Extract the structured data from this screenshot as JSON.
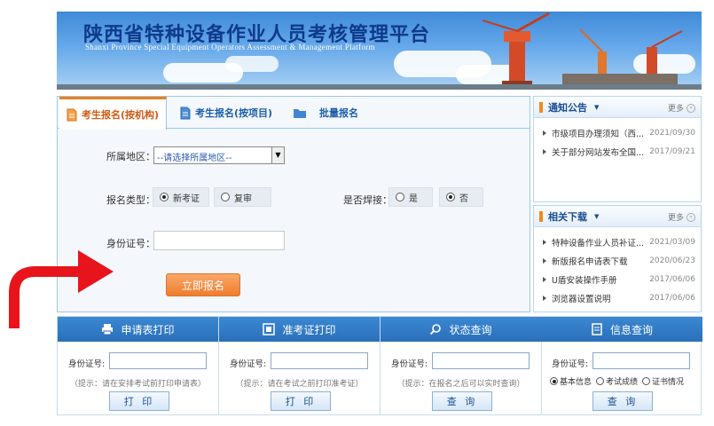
{
  "banner": {
    "title": "陕西省特种设备作业人员考核管理平台",
    "subtitle": "Shanxi Province Special Equipment Operators Assessment & Management Platform"
  },
  "tabs": [
    {
      "label": "考生报名(按机构)",
      "icon": "document-icon",
      "active": true
    },
    {
      "label": "考生报名(按项目)",
      "icon": "document-icon",
      "active": false
    },
    {
      "label": "批量报名",
      "icon": "folder-icon",
      "active": false
    }
  ],
  "form": {
    "region_label": "所属地区：",
    "region_selected": "--请选择所属地区--",
    "type_label": "报名类型：",
    "type_options": [
      "新考证",
      "复审"
    ],
    "type_selected": "新考证",
    "welding_label": "是否焊接：",
    "welding_options": [
      "是",
      "否"
    ],
    "welding_selected": "否",
    "id_label": "身份证号：",
    "id_value": "",
    "submit_label": "立即报名"
  },
  "notices": {
    "title": "通知公告",
    "more": "更多",
    "items": [
      {
        "text": "市级项目办理须知（西...",
        "date": "2021/09/30"
      },
      {
        "text": "关于部分网站发布全国...",
        "date": "2017/09/21"
      }
    ]
  },
  "downloads": {
    "title": "相关下载",
    "more": "更多",
    "items": [
      {
        "text": "特种设备作业人员补证...",
        "date": "2021/03/09"
      },
      {
        "text": "新版报名申请表下载",
        "date": "2020/06/23"
      },
      {
        "text": "U盾安装操作手册",
        "date": "2017/06/06"
      },
      {
        "text": "浏览器设置说明",
        "date": "2017/06/06"
      }
    ]
  },
  "services": [
    {
      "title": "申请表打印",
      "icon": "printer-icon",
      "id_label": "身份证号:",
      "hint": "（提示：请在安排考试前打印申请表）",
      "button": "打 印"
    },
    {
      "title": "准考证打印",
      "icon": "card-icon",
      "id_label": "身份证号:",
      "hint": "（提示：请在考试之前打印准考证）",
      "button": "打 印"
    },
    {
      "title": "状态查询",
      "icon": "search-icon",
      "id_label": "身份证号:",
      "hint": "（提示：在报名之后可以实时查询）",
      "button": "查 询"
    },
    {
      "title": "信息查询",
      "icon": "info-list-icon",
      "id_label": "身份证号:",
      "radios": [
        "基本信息",
        "考试成绩",
        "证书情况"
      ],
      "radio_selected": "基本信息",
      "button": "查 询"
    }
  ],
  "colors": {
    "accent_orange": "#ef7d2d",
    "nav_blue": "#2a6fb9",
    "arrow_red": "#e8141b"
  }
}
